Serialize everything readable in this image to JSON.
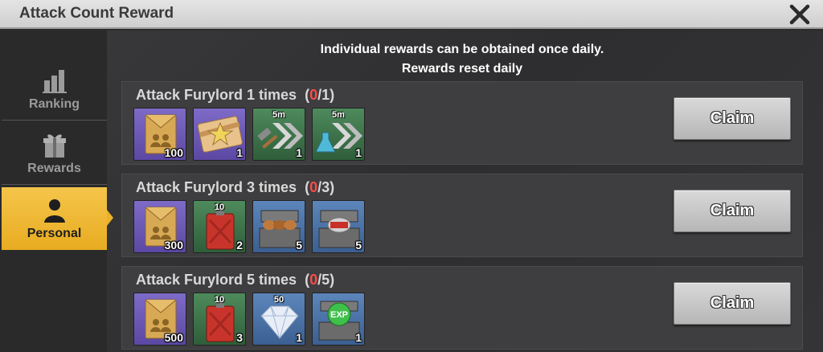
{
  "header": {
    "title": "Attack Count Reward",
    "close_icon": "close-icon"
  },
  "notice": {
    "line1": "Individual rewards can be obtained once daily.",
    "line2": "Rewards reset daily"
  },
  "sidebar": {
    "active_color": "#e8ac21",
    "tabs": [
      {
        "label": "Ranking",
        "icon": "ranking-bars-icon"
      },
      {
        "label": "Rewards",
        "icon": "gift-icon"
      },
      {
        "label": "Personal",
        "icon": "person-icon"
      }
    ]
  },
  "rows": [
    {
      "title": "Attack Furylord 1 times",
      "progress_current": "0",
      "progress_total": "/1)",
      "progress_open": "(",
      "claim_label": "Claim",
      "items": [
        {
          "icon": "envelope-icon",
          "qty": "100"
        },
        {
          "icon": "badge-card-icon",
          "qty": "1"
        },
        {
          "icon": "build-speedup-icon",
          "tag": "5m",
          "qty": "1"
        },
        {
          "icon": "research-speedup-icon",
          "tag": "5m",
          "qty": "1"
        }
      ]
    },
    {
      "title": "Attack Furylord 3 times",
      "progress_current": "0",
      "progress_total": "/3)",
      "progress_open": "(",
      "claim_label": "Claim",
      "items": [
        {
          "icon": "envelope-icon",
          "qty": "300"
        },
        {
          "icon": "fuel-can-icon",
          "tag": "10",
          "qty": "2"
        },
        {
          "icon": "wood-chest-icon",
          "qty": "5"
        },
        {
          "icon": "food-chest-icon",
          "qty": "5"
        }
      ]
    },
    {
      "title": "Attack Furylord 5 times",
      "progress_current": "0",
      "progress_total": "/5)",
      "progress_open": "(",
      "claim_label": "Claim",
      "items": [
        {
          "icon": "envelope-icon",
          "qty": "500"
        },
        {
          "icon": "fuel-can-icon",
          "tag": "10",
          "qty": "3"
        },
        {
          "icon": "diamond-icon",
          "tag": "50",
          "qty": "1"
        },
        {
          "icon": "exp-chest-icon",
          "qty": "1"
        }
      ]
    }
  ]
}
